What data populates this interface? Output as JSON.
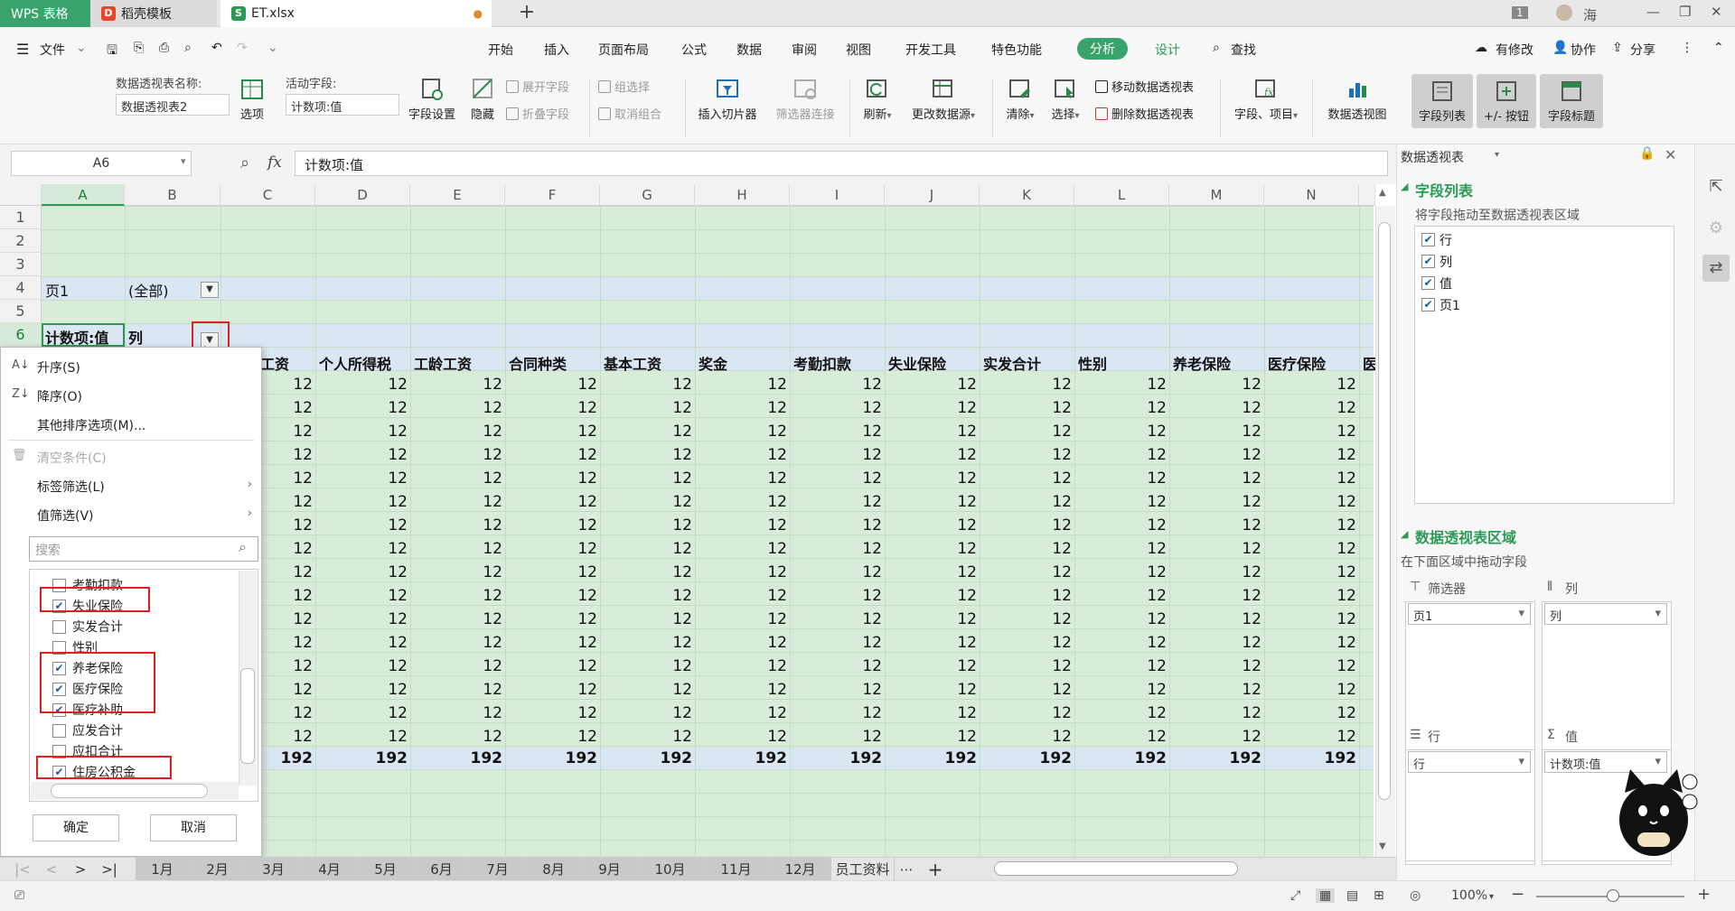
{
  "tabs": {
    "app": "WPS 表格",
    "template": "稻壳模板",
    "file": "ET.xlsx",
    "add": "+"
  },
  "window": {
    "badge": "1",
    "user": "海"
  },
  "menu": {
    "file": "文件",
    "items": [
      "开始",
      "插入",
      "页面布局",
      "公式",
      "数据",
      "审阅",
      "视图",
      "开发工具",
      "特色功能"
    ],
    "analyze": "分析",
    "design": "设计",
    "search": "查找",
    "modified": "有修改",
    "collab": "协作",
    "share": "分享"
  },
  "ribbon": {
    "pt_name_label": "数据透视表名称:",
    "pt_name": "数据透视表2",
    "options": "选项",
    "active_field_label": "活动字段:",
    "active_field": "计数项:值",
    "field_settings": "字段设置",
    "hide": "隐藏",
    "expand": "展开字段",
    "collapse": "折叠字段",
    "group_select": "组选择",
    "ungroup": "取消组合",
    "insert_slicer": "插入切片器",
    "filter_connect": "筛选器连接",
    "refresh": "刷新",
    "change_source": "更改数据源",
    "clear": "清除",
    "select": "选择",
    "move_pt": "移动数据透视表",
    "delete_pt": "删除数据透视表",
    "fields_items": "字段、项目",
    "pt_chart": "数据透视图",
    "field_list": "字段列表",
    "pm_button": "+/- 按钮",
    "field_header": "字段标题"
  },
  "formula": {
    "namebox": "A6",
    "fx": "fx",
    "value": "计数项:值"
  },
  "sheet": {
    "columns": [
      "A",
      "B",
      "C",
      "D",
      "E",
      "F",
      "G",
      "H",
      "I",
      "J",
      "K",
      "L",
      "M",
      "N"
    ],
    "rows": [
      "1",
      "2",
      "3",
      "4",
      "5",
      "6"
    ],
    "page_label": "页1",
    "page_value": "(全部)",
    "count_label": "计数项:值",
    "col_label": "列",
    "headers": [
      "工资",
      "个人所得税",
      "工龄工资",
      "合同种类",
      "基本工资",
      "奖金",
      "考勤扣款",
      "失业保险",
      "实发合计",
      "性别",
      "养老保险",
      "医疗保险",
      "医"
    ],
    "cell_value": "12",
    "total_value": "192"
  },
  "dropdown": {
    "sort_asc": "升序(S)",
    "sort_desc": "降序(O)",
    "more_sort": "其他排序选项(M)...",
    "clear": "清空条件(C)",
    "label_filter": "标签筛选(L)",
    "value_filter": "值筛选(V)",
    "search": "搜索",
    "items": [
      {
        "label": "考勤扣款",
        "checked": false
      },
      {
        "label": "失业保险",
        "checked": true
      },
      {
        "label": "实发合计",
        "checked": false
      },
      {
        "label": "性别",
        "checked": false
      },
      {
        "label": "养老保险",
        "checked": true
      },
      {
        "label": "医疗保险",
        "checked": true
      },
      {
        "label": "医疗补助",
        "checked": true
      },
      {
        "label": "应发合计",
        "checked": false
      },
      {
        "label": "应扣合计",
        "checked": false
      },
      {
        "label": "住房公积金",
        "checked": true
      }
    ],
    "ok": "确定",
    "cancel": "取消"
  },
  "sheet_tabs": [
    "1月",
    "2月",
    "3月",
    "4月",
    "5月",
    "6月",
    "7月",
    "8月",
    "9月",
    "10月",
    "11月",
    "12月",
    "员工资料"
  ],
  "status": {
    "zoom": "100%"
  },
  "pane": {
    "title": "数据透视表",
    "field_list": "字段列表",
    "drag_hint": "将字段拖动至数据透视表区域",
    "fields": [
      "行",
      "列",
      "值",
      "页1"
    ],
    "area_title": "数据透视表区域",
    "area_hint": "在下面区域中拖动字段",
    "filter": "筛选器",
    "column": "列",
    "row": "行",
    "value": "值",
    "filter_val": "页1",
    "column_val": "列",
    "row_val": "行",
    "value_val": "计数项:值"
  },
  "colors": {
    "accent": "#38a36a",
    "pivot_bg": "#d8ecd9",
    "header_band": "#dae6f2",
    "highlight": "#e02020"
  }
}
